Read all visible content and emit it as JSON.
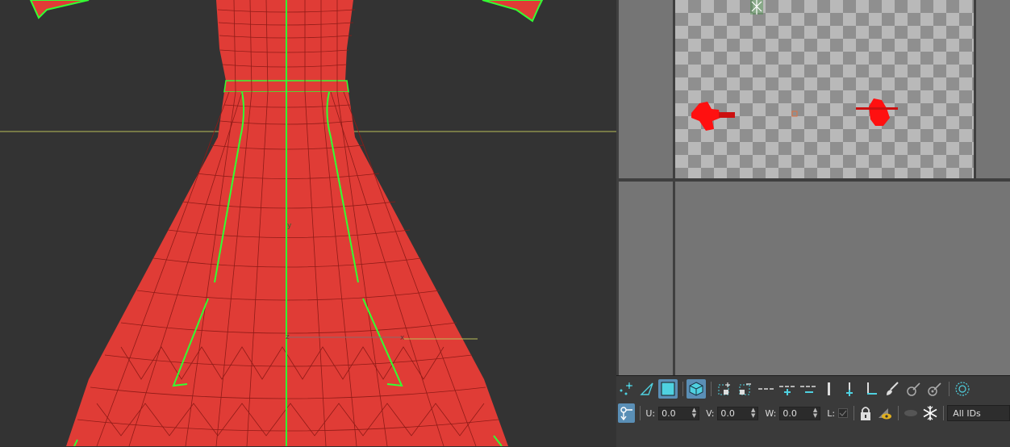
{
  "uv_editor": {
    "u_label": "U:",
    "v_label": "V:",
    "w_label": "W:",
    "l_label": "L:",
    "u_value": "0.0",
    "v_value": "0.0",
    "w_value": "0.0",
    "id_filter": "All IDs"
  },
  "viewport": {
    "axis_y_label": "y",
    "axis_z_label": "z",
    "axis_x_label": "x"
  },
  "colors": {
    "mesh_fill": "#e03c36",
    "mesh_wire": "#8f1b17",
    "seam": "#33ff33",
    "horizon": "#b9bf5a"
  },
  "icons": {
    "toolbar_row1": [
      "vertex-select-icon",
      "edge-select-icon",
      "face-select-icon",
      "element-select-icon",
      "rect-select-icon",
      "shrink-select-icon",
      "edge-loop-icon",
      "edge-ring-grow-icon",
      "edge-ring-shrink-icon",
      "separator-bar-icon",
      "align-vertical-icon",
      "align-horizontal-icon",
      "paint-select-icon",
      "soft-select-icon",
      "soft-select-falloff-icon",
      "target-icon"
    ],
    "toolbar_row2": [
      "transform-mode-icon",
      "lock-icon",
      "visibility-icon",
      "freeze-icon"
    ]
  }
}
